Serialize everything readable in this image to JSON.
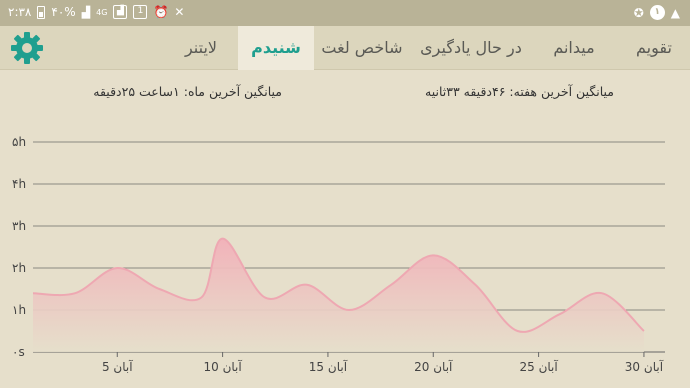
{
  "status_bar": {
    "time": "۲:۳۸",
    "battery_percent": "۴۰%",
    "network": "4G",
    "notification_count": "۱"
  },
  "tabs": [
    {
      "label": "تقویم",
      "active": false
    },
    {
      "label": "میدانم",
      "active": false
    },
    {
      "label": "در حال یادگیری",
      "active": false
    },
    {
      "label": "شاخص لغت",
      "active": false
    },
    {
      "label": "شنیدم",
      "active": true
    },
    {
      "label": "لایتنر",
      "active": false
    }
  ],
  "accent_color": "#1f9f8f",
  "averages": {
    "week": "میانگین آخرین هفته: ۴۶دقیقه  ۳۳ثانیه",
    "month": "میانگین آخرین ماه: ۱ساعت  ۲۵دقیقه"
  },
  "chart_data": {
    "type": "area",
    "x": [
      1,
      3,
      5,
      7,
      9,
      10,
      12,
      14,
      16,
      18,
      20,
      22,
      24,
      26,
      28,
      30
    ],
    "values": [
      1.4,
      1.4,
      2.0,
      1.5,
      1.3,
      2.7,
      1.3,
      1.6,
      1.0,
      1.6,
      2.3,
      1.6,
      0.5,
      0.9,
      1.4,
      0.5
    ],
    "x_ticks": [
      {
        "x": 5,
        "label": "5 آبان"
      },
      {
        "x": 10,
        "label": "10 آبان"
      },
      {
        "x": 15,
        "label": "15 آبان"
      },
      {
        "x": 20,
        "label": "20 آبان"
      },
      {
        "x": 25,
        "label": "25 آبان"
      },
      {
        "x": 30,
        "label": "30 آبان"
      }
    ],
    "y_ticks": [
      {
        "value": 0,
        "label": "۰s"
      },
      {
        "value": 1,
        "label": "۱h"
      },
      {
        "value": 2,
        "label": "۲h"
      },
      {
        "value": 3,
        "label": "۳h"
      },
      {
        "value": 4,
        "label": "۴h"
      },
      {
        "value": 5,
        "label": "۵h"
      }
    ],
    "ylim": [
      0,
      5
    ],
    "xlim": [
      1,
      31
    ],
    "grid": true,
    "fill_color": "#f2b0b9",
    "line_color": "#eea8b2"
  }
}
